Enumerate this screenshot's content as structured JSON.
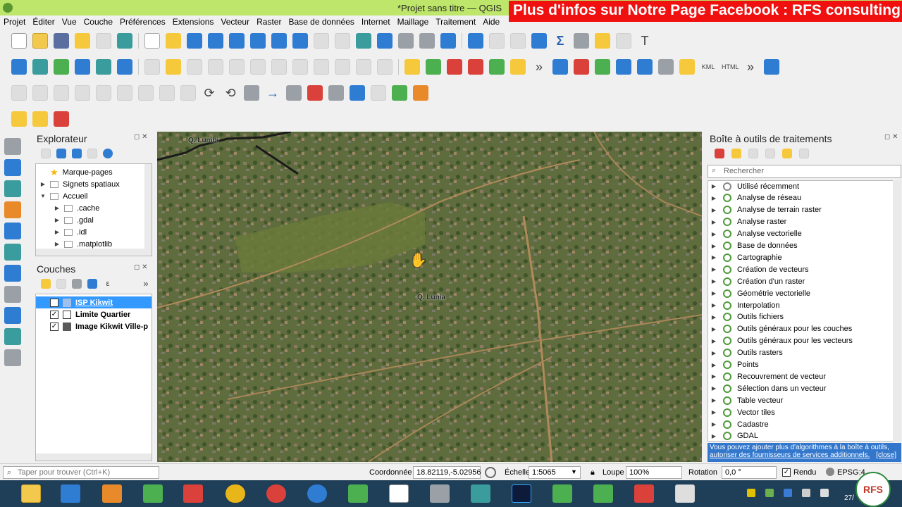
{
  "window": {
    "title": "*Projet sans titre — QGIS"
  },
  "banner": {
    "text": "Plus d'infos sur Notre Page Facebook : RFS consulting"
  },
  "menu": [
    "Projet",
    "Éditer",
    "Vue",
    "Couche",
    "Préférences",
    "Extensions",
    "Vecteur",
    "Raster",
    "Base de données",
    "Internet",
    "Maillage",
    "Traitement",
    "Aide"
  ],
  "toolbar2": {
    "kml": "KML",
    "html": "HTML"
  },
  "explorer": {
    "title": "Explorateur",
    "items": [
      ".cache",
      ".gdal",
      ".idl",
      ".matplotlib"
    ],
    "bookmarks": "Marque-pages",
    "spatial": "Signets spatiaux",
    "home": "Accueil"
  },
  "layers": {
    "title": "Couches",
    "items": [
      {
        "name": "ISP Kikwit",
        "checked": true
      },
      {
        "name": "Limite Quartier",
        "checked": true
      },
      {
        "name": "Image Kikwit Ville-p",
        "checked": true
      }
    ]
  },
  "map": {
    "label1": "Q. Lumbi",
    "label2": "Q. Lunia"
  },
  "processing": {
    "title": "Boîte à outils de traitements",
    "search_placeholder": "Rechercher",
    "items": [
      "Utilisé récemment",
      "Analyse de réseau",
      "Analyse de terrain raster",
      "Analyse raster",
      "Analyse vectorielle",
      "Base de données",
      "Cartographie",
      "Création de vecteurs",
      "Création d'un raster",
      "Géométrie vectorielle",
      "Interpolation",
      "Outils fichiers",
      "Outils généraux pour les couches",
      "Outils généraux pour les vecteurs",
      "Outils rasters",
      "Points",
      "Recouvrement de vecteur",
      "Sélection dans un vecteur",
      "Table vecteur",
      "Vector tiles",
      "Cadastre",
      "GDAL"
    ],
    "info_line1": "Vous pouvez ajouter plus d'algorithmes à la boîte à outils,",
    "info_link": "autoriser des fournisseurs de services additionnels.",
    "info_close": "[close]"
  },
  "status": {
    "locator_placeholder": "Taper pour trouver (Ctrl+K)",
    "coord_label": "Coordonnée",
    "coord_value": "18.82119,-5.02956",
    "scale_label": "Échelle",
    "scale_value": "1:5065",
    "magnifier_label": "Loupe",
    "magnifier_value": "100%",
    "rotation_label": "Rotation",
    "rotation_value": "0,0 °",
    "render_label": "Rendu",
    "epsg": "EPSG:4",
    "clock": "27/"
  },
  "logo": {
    "text": "RFS"
  },
  "colors": {
    "title_bar": "#bde66a",
    "banner": "#f01010",
    "selected": "#3399ff",
    "taskbar": "#1f3e57"
  }
}
